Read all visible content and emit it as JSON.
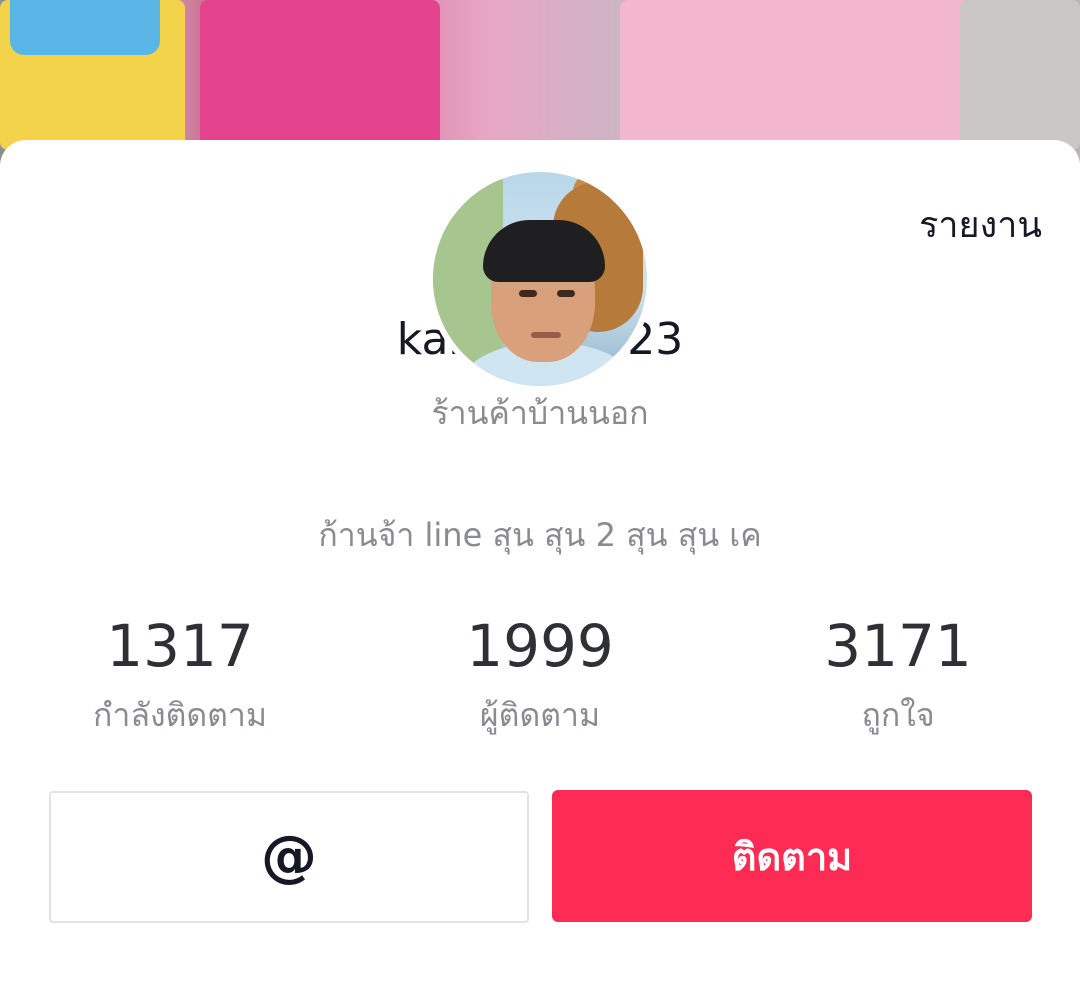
{
  "header": {
    "report_label": "รายงาน"
  },
  "profile": {
    "username": "karnshop123",
    "display_name": "ร้านค้าบ้านนอก",
    "bio": "ก้านจ้า line สุน สุน 2 สุน สุน เค"
  },
  "stats": [
    {
      "count": "1317",
      "label": "กำลังติดตาม"
    },
    {
      "count": "1999",
      "label": "ผู้ติดตาม"
    },
    {
      "count": "3171",
      "label": "ถูกใจ"
    }
  ],
  "actions": {
    "mention_icon": "@",
    "follow_label": "ติดตาม"
  },
  "colors": {
    "follow_button": "#fe2c55",
    "primary_text": "#161823",
    "secondary_text": "#8a8b91"
  },
  "icons": {
    "mention": "at-sign-icon"
  }
}
